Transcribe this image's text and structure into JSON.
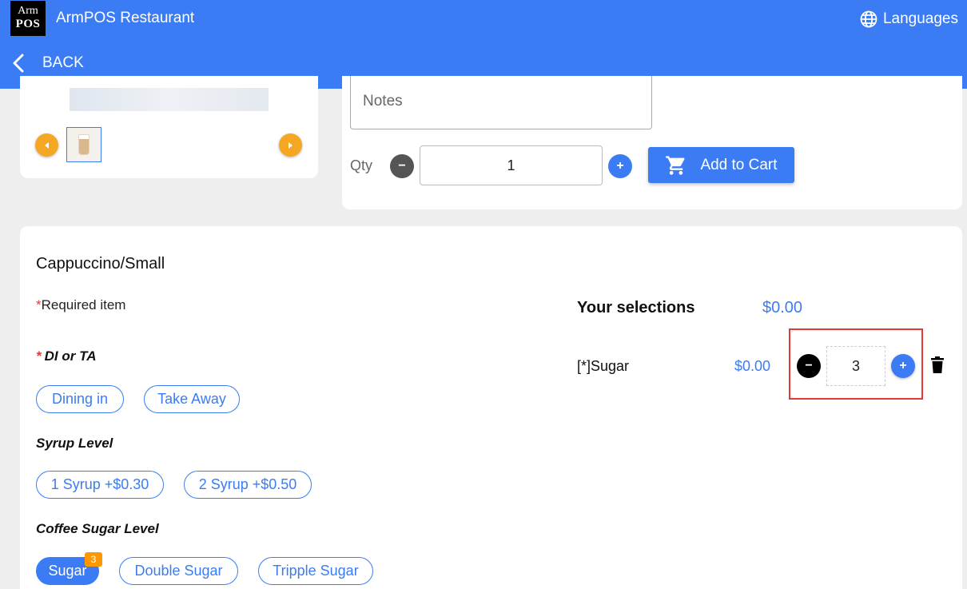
{
  "header": {
    "logo_line1": "Arm",
    "logo_line2": "POS",
    "app_title": "ArmPOS Restaurant",
    "languages_label": "Languages",
    "back_label": "BACK"
  },
  "order": {
    "notes_placeholder": "Notes",
    "qty_label": "Qty",
    "qty_value": "1",
    "minus_symbol": "−",
    "plus_symbol": "+",
    "add_to_cart_label": "Add to Cart"
  },
  "product": {
    "title": "Cappuccino/Small",
    "required_star": "*",
    "required_label": "Required item",
    "groups": [
      {
        "required": "*",
        "title": "DI or TA",
        "options": [
          "Dining in",
          "Take Away"
        ]
      },
      {
        "title": "Syrup Level",
        "options": [
          "1 Syrup +$0.30",
          "2 Syrup +$0.50"
        ]
      },
      {
        "title": "Coffee Sugar Level",
        "options": [
          "Sugar",
          "Double Sugar",
          "Tripple Sugar"
        ],
        "active_option": "Sugar",
        "active_badge": "3"
      }
    ]
  },
  "selections": {
    "title": "Your selections",
    "total": "$0.00",
    "items": [
      {
        "name": "[*]Sugar",
        "price": "$0.00",
        "qty": "3"
      }
    ]
  },
  "colors": {
    "primary": "#3b7cf4",
    "accent": "#f5a623",
    "badge": "#ff9800",
    "highlight": "#e53935"
  },
  "icons": [
    "globe-icon",
    "chevron-left-icon",
    "cart-icon",
    "trash-icon",
    "minus-icon",
    "plus-icon",
    "arrow-left-icon",
    "arrow-right-icon"
  ]
}
